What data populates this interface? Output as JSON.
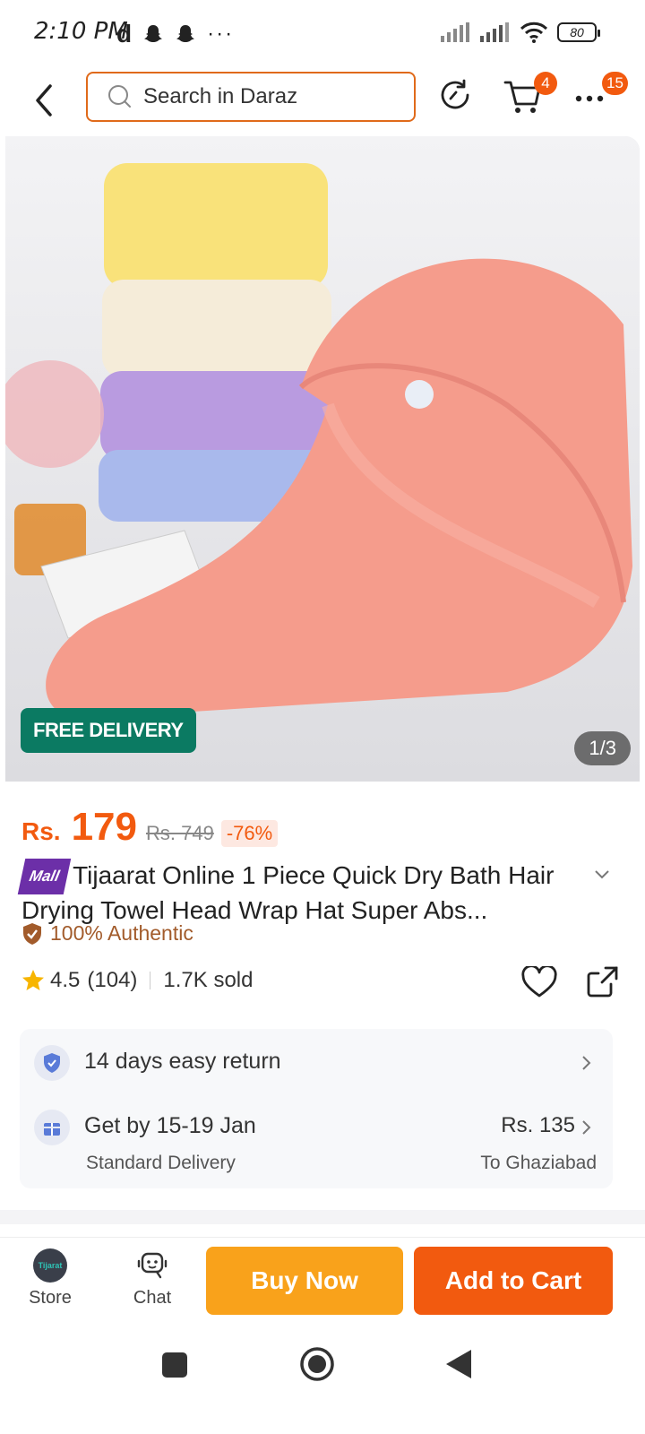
{
  "status": {
    "time": "2:10 PM",
    "battery": "80"
  },
  "header": {
    "search_placeholder": "Search in Daraz",
    "cart_count": "4",
    "menu_count": "15"
  },
  "gallery": {
    "free_delivery": "FREE DELIVERY",
    "pager": "1/3"
  },
  "price": {
    "currency": "Rs.",
    "current": "179",
    "original": "Rs. 749",
    "discount": "-76%"
  },
  "product": {
    "mall_badge": "Mall",
    "title": "Tijaarat Online  1 Piece Quick Dry Bath Hair Drying Towel Head Wrap Hat Super Abs...",
    "authentic": "100% Authentic",
    "rating": "4.5",
    "reviews": "(104)",
    "sold": "1.7K sold"
  },
  "services": {
    "return_text": "14 days easy return",
    "delivery_text": "Get by 15-19 Jan",
    "delivery_type": "Standard Delivery",
    "delivery_price": "Rs. 135",
    "delivery_location": "To Ghaziabad"
  },
  "actions": {
    "store_label": "Store",
    "store_logo": "Tijarat",
    "chat_label": "Chat",
    "buy_now": "Buy Now",
    "add_to_cart": "Add to Cart"
  },
  "colors": {
    "accent": "#f25a0f",
    "buy": "#f9a21b",
    "free_delivery": "#0b7a62"
  }
}
